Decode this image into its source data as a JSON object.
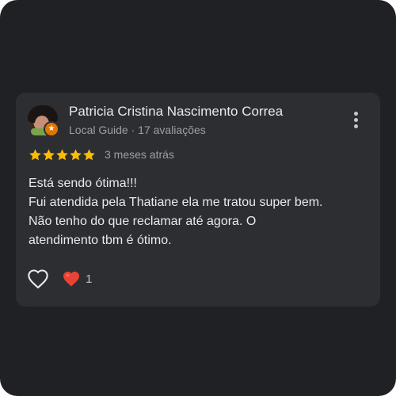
{
  "review": {
    "author_name": "Patricia Cristina Nascimento Correa",
    "author_meta": "Local Guide · 17 avaliações",
    "rating": 5,
    "rating_max": 5,
    "time_ago": "3 meses atrás",
    "lines": [
      "Está sendo ótima!!!",
      "Fui atendida pela Thatiane ela me tratou super bem.",
      "Não tenho do que reclamar até agora. O",
      "atendimento tbm é ótimo."
    ],
    "reaction_count": "1"
  },
  "colors": {
    "background": "#202124",
    "card": "#2d2e31",
    "star": "#fbbc04",
    "text_primary": "#e8eaed",
    "text_secondary": "#9aa0a6",
    "heart": "#ea4335",
    "guide_badge": "#e37400"
  },
  "icons": {
    "menu": "more-vert-icon",
    "like": "heart-outline-icon",
    "reaction": "red-heart-icon",
    "star": "star-icon",
    "badge": "local-guide-badge-icon"
  }
}
